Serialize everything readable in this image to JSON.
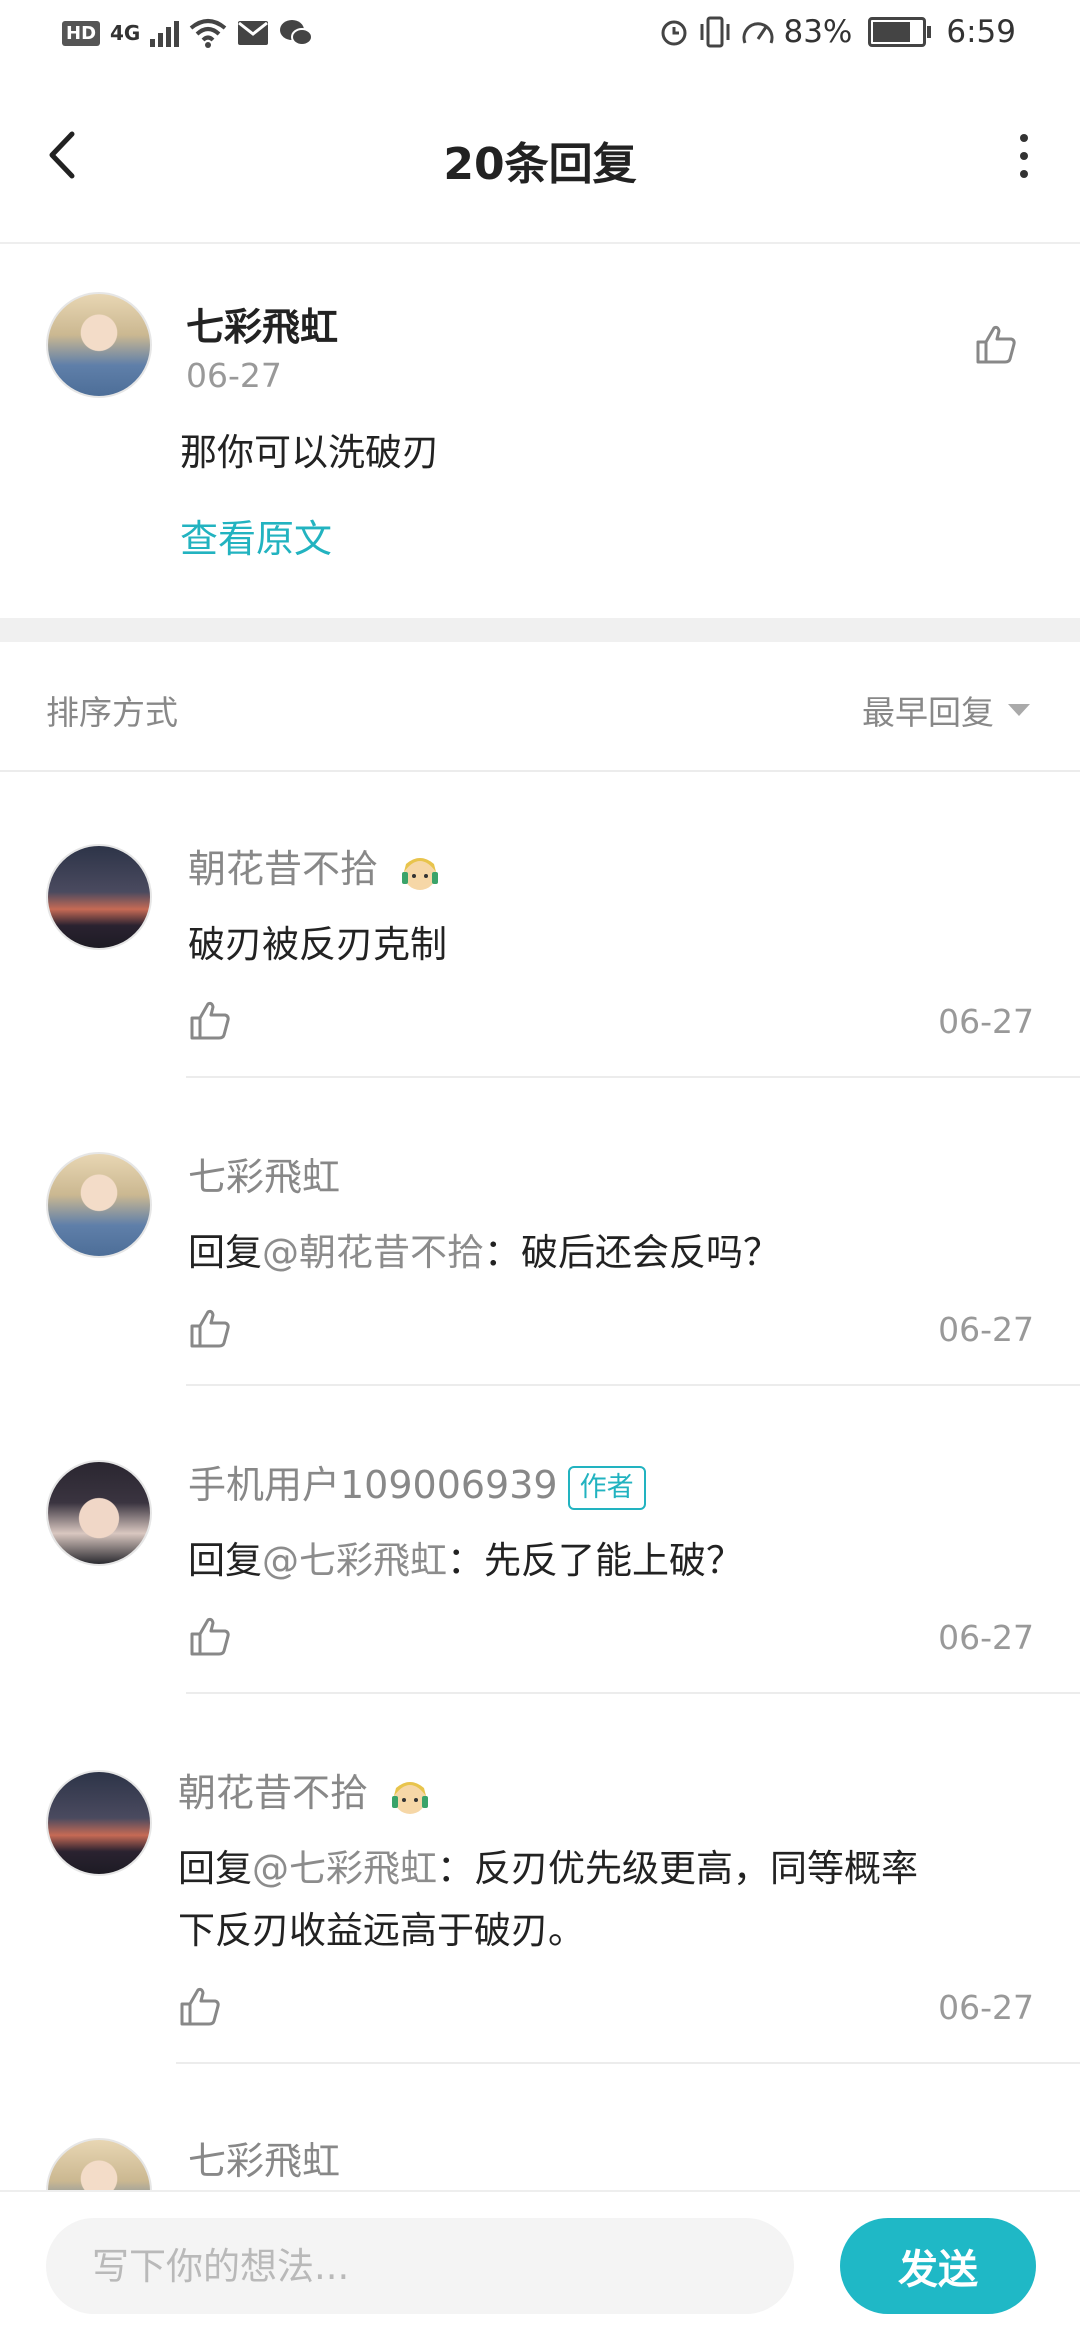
{
  "status_bar": {
    "hd": "HD",
    "network": "4G",
    "battery_pct": "83%",
    "battery_level": 0.83,
    "time": "6:59"
  },
  "header": {
    "title": "20条回复"
  },
  "original": {
    "username": "七彩飛虹",
    "date": "06-27",
    "content": "那你可以洗破刃",
    "view_original": "查看原文"
  },
  "sort": {
    "label": "排序方式",
    "selected": "最早回复"
  },
  "replies": [
    {
      "username": "朝花昔不拾",
      "prefix": "",
      "mention": "",
      "text": "破刃被反刃克制",
      "date": "06-27"
    },
    {
      "username": "七彩飛虹",
      "prefix": "回复",
      "mention": "@朝花昔不拾",
      "text": "：破后还会反吗？",
      "date": "06-27"
    },
    {
      "username": "手机用户109006939",
      "badge": "作者",
      "prefix": "回复",
      "mention": "@七彩飛虹",
      "text": "：先反了能上破？",
      "date": "06-27"
    },
    {
      "username": "朝花昔不拾",
      "prefix": "回复",
      "mention": "@七彩飛虹",
      "text": "：反刃优先级更高，同等概率",
      "text2": "下反刃收益远高于破刃。",
      "date": "06-27"
    },
    {
      "username": "七彩飛虹"
    }
  ],
  "bottom": {
    "placeholder": "写下你的想法...",
    "send_label": "发送"
  },
  "colors": {
    "accent": "#1fb8c6",
    "link": "#22b3c0"
  }
}
